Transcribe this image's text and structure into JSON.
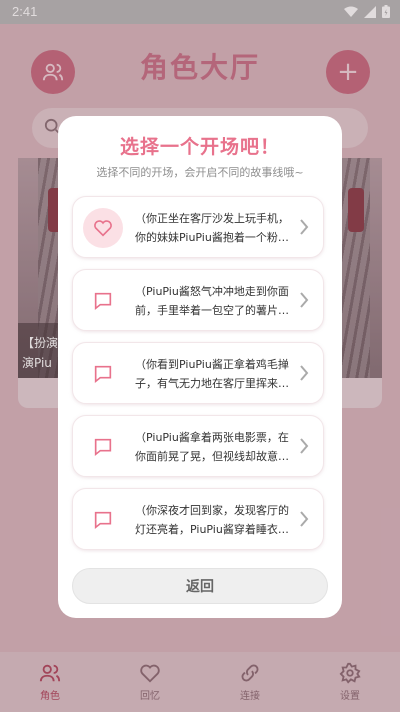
{
  "status_bar": {
    "time": "2:41"
  },
  "app": {
    "title": "角色大厅",
    "cards": [
      {
        "caption_line1": "【扮演",
        "caption_line2": "演Piu"
      }
    ]
  },
  "bottom_nav": [
    {
      "label": "角色",
      "icon": "people-icon",
      "active": true
    },
    {
      "label": "回忆",
      "icon": "heart-icon",
      "active": false
    },
    {
      "label": "连接",
      "icon": "link-icon",
      "active": false
    },
    {
      "label": "设置",
      "icon": "gear-icon",
      "active": false
    }
  ],
  "dialog": {
    "title": "选择一个开场吧！",
    "subtitle": "选择不同的开场，会开启不同的故事线哦~",
    "options": [
      {
        "text": "（你正坐在客厅沙发上玩手机，你的妹妹PiuPiu酱抱着一个粉…",
        "icon": "heart-icon"
      },
      {
        "text": "（PiuPiu酱怒气冲冲地走到你面前，手里举着一包空了的薯片…",
        "icon": "chat-icon"
      },
      {
        "text": "（你看到PiuPiu酱正拿着鸡毛掸子，有气无力地在客厅里挥来…",
        "icon": "chat-icon"
      },
      {
        "text": "（PiuPiu酱拿着两张电影票，在你面前晃了晃，但视线却故意…",
        "icon": "chat-icon"
      },
      {
        "text": "（你深夜才回到家，发现客厅的灯还亮着，PiuPiu酱穿着睡衣…",
        "icon": "chat-icon"
      }
    ],
    "back_label": "返回"
  },
  "colors": {
    "accent": "#e8728c",
    "dialog_bg": "#ffffff"
  }
}
